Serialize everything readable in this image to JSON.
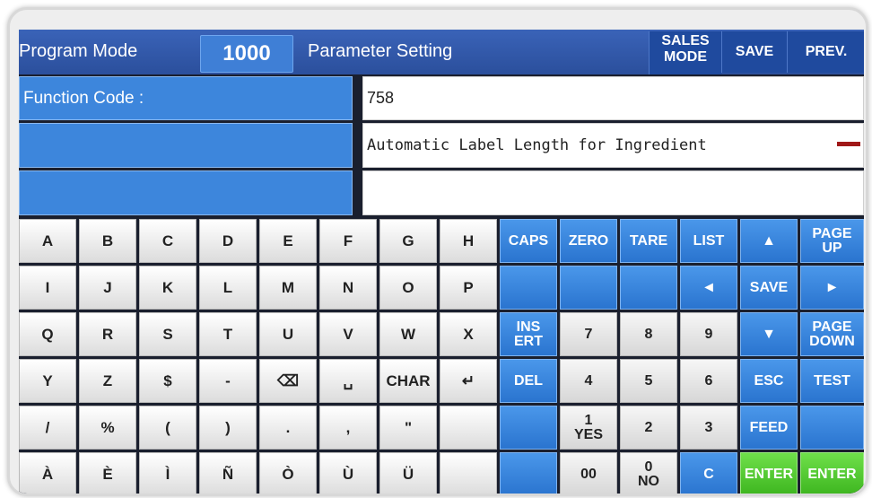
{
  "header": {
    "program_mode_label": "Program Mode",
    "mode_value": "1000",
    "parameter_label": "Parameter Setting",
    "sales_mode_line1": "SALES",
    "sales_mode_line2": "MODE",
    "save_label": "SAVE",
    "prev_label": "PREV."
  },
  "rows": {
    "function_code_label": "Function Code :",
    "function_code_value": "758",
    "description_value": "Automatic Label Length for Ingredient",
    "row3_value": ""
  },
  "keyboard": {
    "letter_rows": [
      [
        "A",
        "B",
        "C",
        "D",
        "E",
        "F",
        "G",
        "H"
      ],
      [
        "I",
        "J",
        "K",
        "L",
        "M",
        "N",
        "O",
        "P"
      ],
      [
        "Q",
        "R",
        "S",
        "T",
        "U",
        "V",
        "W",
        "X"
      ],
      [
        "Y",
        "Z",
        "$",
        "-",
        "⌫",
        "␣",
        "CHAR",
        "↵"
      ],
      [
        "/",
        "%",
        "(",
        ")",
        ".",
        ",",
        "\"",
        ""
      ],
      [
        "À",
        "È",
        "Ì",
        "Ñ",
        "Ò",
        "Ù",
        "Ü",
        ""
      ]
    ],
    "function_rows": [
      [
        "CAPS",
        "ZERO",
        "TARE",
        "LIST",
        "▲",
        "PAGE UP"
      ],
      [
        "",
        "",
        "",
        "◄",
        "SAVE",
        "►"
      ],
      [
        "INS ERT",
        "7",
        "8",
        "9",
        "▼",
        "PAGE DOWN"
      ],
      [
        "DEL",
        "4",
        "5",
        "6",
        "ESC",
        "TEST"
      ],
      [
        "",
        "1 YES",
        "2",
        "3",
        "FEED",
        ""
      ],
      [
        "",
        "00",
        "0 NO",
        "C",
        "ENTER",
        "ENTER"
      ]
    ]
  },
  "colors": {
    "header_blue": "#2b4f9c",
    "key_blue": "#2a74cf",
    "enter_green": "#3db51f"
  }
}
